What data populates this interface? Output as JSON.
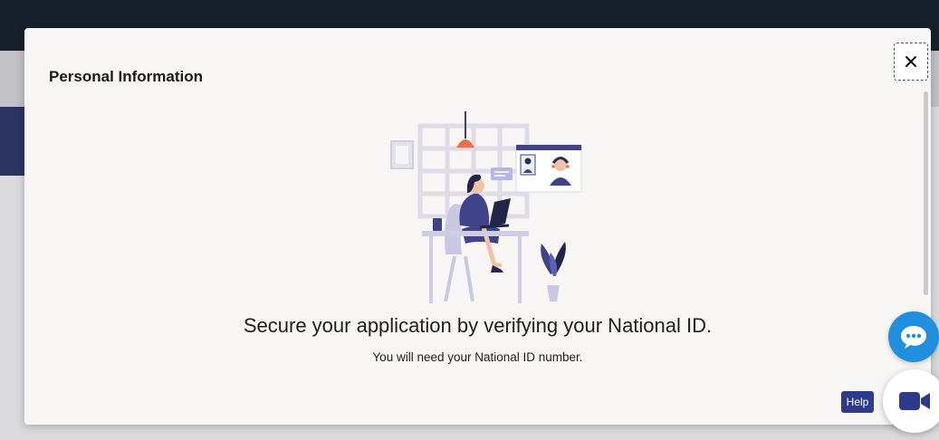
{
  "modal": {
    "title": "Personal Information",
    "headline": "Secure your application by verifying your National ID.",
    "subline": "You will need your National ID number."
  },
  "widgets": {
    "help_label": "Help"
  },
  "colors": {
    "accent_blue": "#1f8fde",
    "help_navy": "#2e3a8c",
    "topbar": "#1b2230"
  },
  "icons": {
    "close": "close-icon",
    "chat": "chat-bubble-icon",
    "video": "video-camera-icon"
  }
}
